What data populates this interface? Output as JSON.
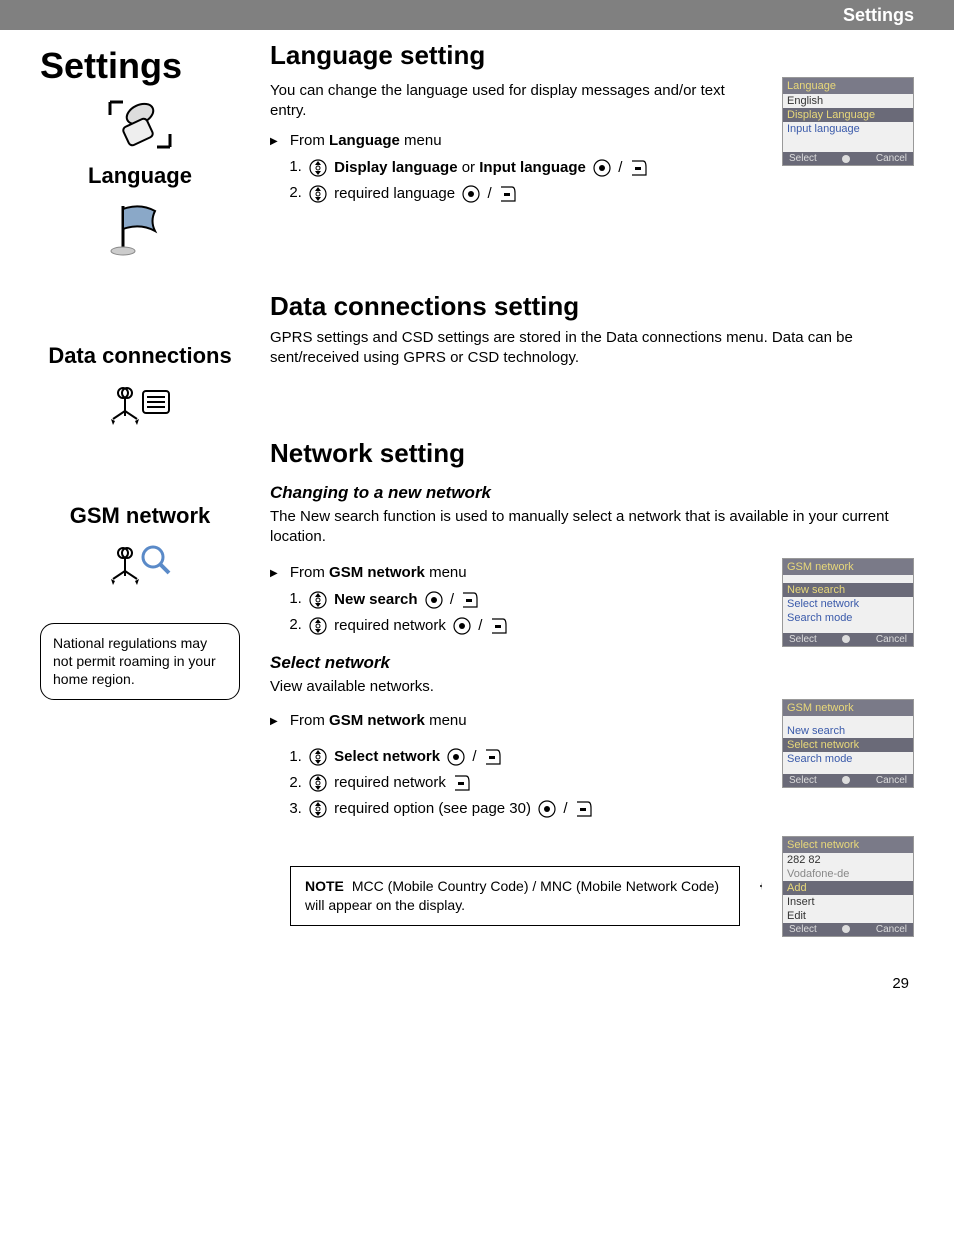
{
  "header": {
    "title": "Settings"
  },
  "page_number": "29",
  "sidebar": {
    "title": "Settings",
    "sections": [
      {
        "label": "Language"
      },
      {
        "label": "Data connections"
      },
      {
        "label": "GSM network"
      }
    ],
    "callout": "National regulations may not permit roaming in your home region."
  },
  "language_section": {
    "heading": "Language setting",
    "intro": "You can change the language used for display messages and/or text entry.",
    "from_label": "From ",
    "from_menu": "Language",
    "from_suffix": " menu",
    "steps": [
      {
        "bold1": "Display language",
        "mid": " or ",
        "bold2": "Input language"
      },
      {
        "text": " required language "
      }
    ],
    "screenshot": {
      "title": "Language",
      "rows": [
        "English",
        "Display Language",
        "Input language"
      ],
      "soft_left": "Select",
      "soft_right": "Cancel"
    }
  },
  "data_section": {
    "heading": "Data connections setting",
    "body": "GPRS settings and CSD settings are stored in the Data connections menu. Data can be sent/received using GPRS or CSD technology."
  },
  "network_section": {
    "heading": "Network setting",
    "sub1": {
      "title": "Changing to a new network",
      "body": "The New search function is used to manually select a network that is available in your current location.",
      "from_label": "From ",
      "from_menu": "GSM network",
      "from_suffix": " menu",
      "steps": [
        {
          "bold": "New search"
        },
        {
          "text": " required network "
        }
      ],
      "screenshot": {
        "title": "GSM network",
        "rows": [
          "New search",
          "Select network",
          "Search mode"
        ],
        "soft_left": "Select",
        "soft_right": "Cancel"
      }
    },
    "sub2": {
      "title": "Select network",
      "body": "View available networks.",
      "from_label": "From ",
      "from_menu": "GSM network",
      "from_suffix": " menu",
      "steps": [
        {
          "bold": "Select network"
        },
        {
          "text": " required network "
        },
        {
          "text": " required option (see page 30) "
        }
      ],
      "screenshot": {
        "title": "GSM network",
        "rows": [
          "New search",
          "Select network",
          "Search mode"
        ],
        "soft_left": "Select",
        "soft_right": "Cancel"
      }
    },
    "note": {
      "label": "NOTE",
      "text": "MCC (Mobile Country Code) / MNC (Mobile Network Code) will appear on the display."
    },
    "note_screenshot": {
      "title": "Select network",
      "rows": [
        "282 82",
        "Vodafone-de",
        "Add",
        "Insert",
        "Edit"
      ],
      "soft_left": "Select",
      "soft_right": "Cancel"
    }
  }
}
